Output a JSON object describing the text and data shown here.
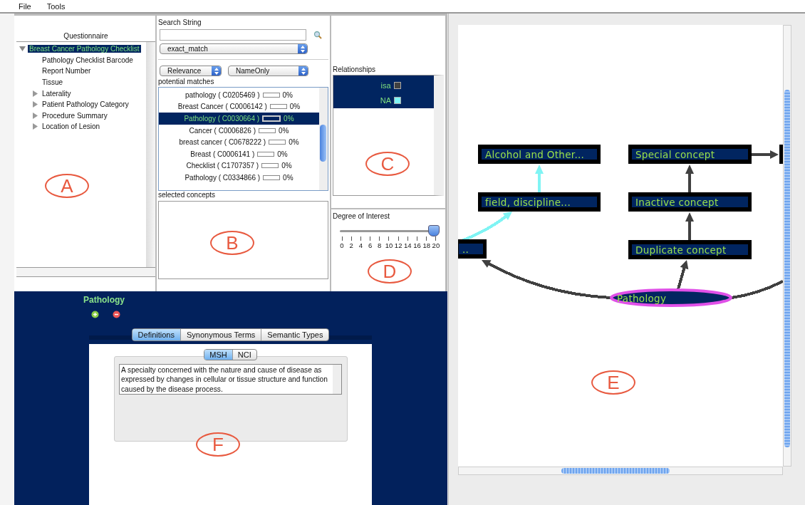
{
  "menu": [
    "File",
    "Tools"
  ],
  "questionnaire": {
    "title": "Questionnaire",
    "tree": [
      {
        "label": "Breast Cancer Pathology Checklist",
        "selected": true,
        "expanded": true,
        "children": [
          {
            "label": "Pathology Checklist Barcode",
            "selected": false,
            "kind": "leaf"
          },
          {
            "label": "Report Number",
            "selected": false,
            "kind": "leaf"
          },
          {
            "label": "Tissue",
            "selected": false,
            "kind": "leaf"
          },
          {
            "label": "Laterality",
            "selected": false,
            "kind": "folder"
          },
          {
            "label": "Patient Pathology Category",
            "selected": false,
            "kind": "folder"
          },
          {
            "label": "Procedure Summary",
            "selected": false,
            "kind": "folder"
          },
          {
            "label": "Location of Lesion",
            "selected": false,
            "kind": "folder"
          }
        ]
      }
    ]
  },
  "search": {
    "label": "Search String",
    "match_mode": "exact_match",
    "sort": "Relevance",
    "scope": "NameOnly",
    "matches_label": "potential matches",
    "matches": [
      {
        "name": "pathology ( C0205469 )",
        "level": 0,
        "percent": "0%",
        "selected": false
      },
      {
        "name": "Breast Cancer ( C0006142 )",
        "level": 0,
        "percent": "0%",
        "selected": false
      },
      {
        "name": "Pathology ( C0030664 )",
        "level": 0,
        "percent": "0%",
        "selected": true
      },
      {
        "name": "Cancer ( C0006826 )",
        "level": 0,
        "percent": "0%",
        "selected": false
      },
      {
        "name": "breast cancer ( C0678222 )",
        "level": 0,
        "percent": "0%",
        "selected": false
      },
      {
        "name": "Breast ( C0006141 )",
        "level": 0,
        "percent": "0%",
        "selected": false
      },
      {
        "name": "Checklist ( C1707357 )",
        "level": 0,
        "percent": "0%",
        "selected": false
      },
      {
        "name": "Pathology ( C0334866 )",
        "level": 0,
        "percent": "0%",
        "selected": false
      }
    ],
    "selected_label": "selected concepts"
  },
  "relationships": {
    "title": "Relationships",
    "items": [
      {
        "label": "isa",
        "color": "#404040"
      },
      {
        "label": "NA",
        "color": "#80f4f4"
      }
    ]
  },
  "interest": {
    "title": "Degree of Interest",
    "level": 1,
    "ticks": [
      "0",
      "2",
      "4",
      "6",
      "8",
      "10",
      "12",
      "14",
      "16",
      "18",
      "20"
    ]
  },
  "concept": {
    "title": "Pathology",
    "tabs": [
      {
        "label": "Definitions",
        "selected": true
      },
      {
        "label": "Synonymous Terms",
        "selected": false
      },
      {
        "label": "Semantic Types",
        "selected": false
      }
    ],
    "sources": [
      {
        "label": "MSH",
        "selected": true
      },
      {
        "label": "NCI",
        "selected": false
      }
    ],
    "definition": "A specialty concerned with the nature and cause of disease as expressed by changes in cellular or tissue structure and function caused by the disease process."
  },
  "graph": {
    "nodes": [
      {
        "kind": "box",
        "label": "Alcohol and Other..."
      },
      {
        "kind": "box",
        "label": "Special concept"
      },
      {
        "kind": "stub"
      },
      {
        "kind": "box",
        "label": "field, discipline..."
      },
      {
        "kind": "box",
        "label": "Inactive concept"
      },
      {
        "kind": "box",
        "label": ".."
      },
      {
        "kind": "box",
        "label": "Duplicate concept"
      },
      {
        "kind": "focus",
        "label": "Pathology"
      }
    ],
    "edges": [
      {
        "color": "#80f4f4"
      },
      {
        "color": "#80f4f4"
      },
      {
        "color": "#404040"
      },
      {
        "color": "#404040"
      },
      {
        "color": "#404040"
      },
      {
        "color": "#404040"
      },
      {
        "color": "#404040"
      },
      {
        "color": "#404040"
      }
    ]
  },
  "annotations": [
    "A",
    "B",
    "C",
    "D",
    "E",
    "F"
  ]
}
